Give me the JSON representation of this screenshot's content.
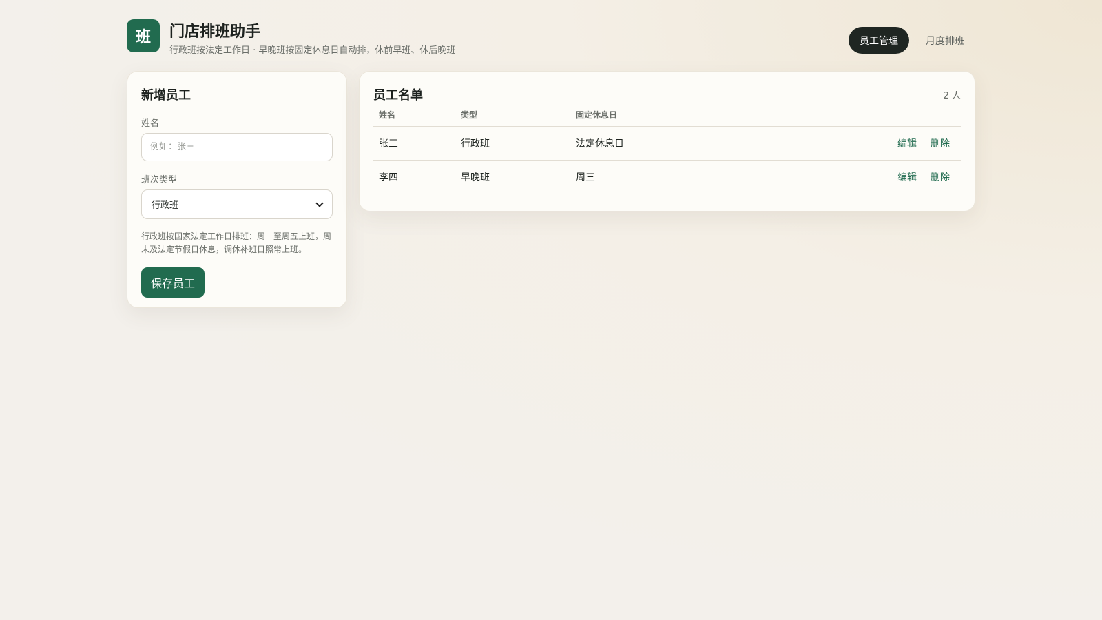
{
  "header": {
    "logo_char": "班",
    "title": "门店排班助手",
    "subtitle": "行政班按法定工作日 · 早晚班按固定休息日自动排，休前早班、休后晚班",
    "nav": [
      {
        "label": "员工管理",
        "active": true
      },
      {
        "label": "月度排班",
        "active": false
      }
    ]
  },
  "form": {
    "title": "新增员工",
    "name_label": "姓名",
    "name_placeholder": "例如：张三",
    "name_value": "",
    "type_label": "班次类型",
    "type_value": "行政班",
    "helper": "行政班按国家法定工作日排班：周一至周五上班，周末及法定节假日休息，调休补班日照常上班。",
    "save_label": "保存员工"
  },
  "roster": {
    "title": "员工名单",
    "count": "2 人",
    "columns": [
      "姓名",
      "类型",
      "固定休息日"
    ],
    "rows": [
      {
        "name": "张三",
        "type": "行政班",
        "rest": "法定休息日",
        "edit": "编辑",
        "delete": "删除"
      },
      {
        "name": "李四",
        "type": "早晚班",
        "rest": "周三",
        "edit": "编辑",
        "delete": "删除"
      }
    ]
  },
  "colors": {
    "accent": "#216b4f",
    "dark": "#1f2622",
    "background": "#f3f0eb"
  }
}
